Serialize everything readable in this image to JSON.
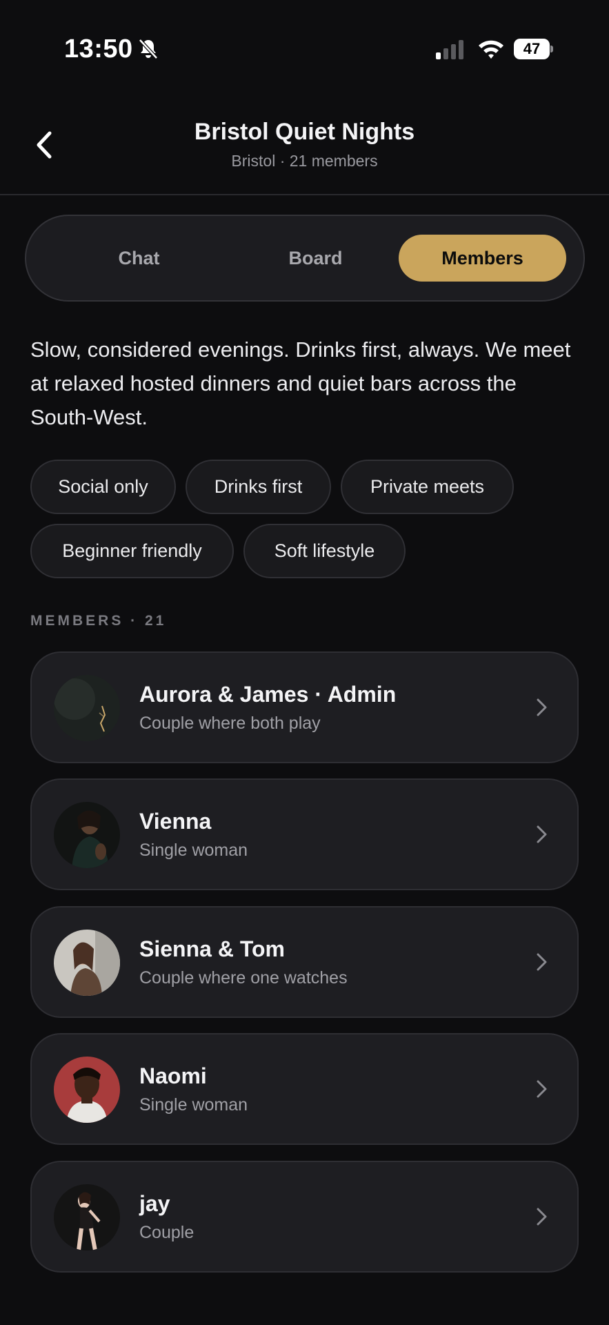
{
  "status_bar": {
    "time": "13:50",
    "battery": "47"
  },
  "header": {
    "title": "Bristol Quiet Nights",
    "subtitle": "Bristol · 21 members"
  },
  "tabs": [
    {
      "label": "Chat",
      "active": false
    },
    {
      "label": "Board",
      "active": false
    },
    {
      "label": "Members",
      "active": true
    }
  ],
  "description": "Slow, considered evenings. Drinks first, always. We meet at relaxed hosted dinners and quiet bars across the South-West.",
  "tags": [
    "Social only",
    "Drinks first",
    "Private meets",
    "Beginner friendly",
    "Soft lifestyle"
  ],
  "members_section": {
    "label": "MEMBERS · 21"
  },
  "members": [
    {
      "name": "Aurora & James · Admin",
      "type": "Couple where both play"
    },
    {
      "name": "Vienna",
      "type": "Single woman"
    },
    {
      "name": "Sienna & Tom",
      "type": "Couple where one watches"
    },
    {
      "name": "Naomi",
      "type": "Single woman"
    },
    {
      "name": "jay",
      "type": "Couple"
    }
  ],
  "colors": {
    "background": "#0d0d0f",
    "accent": "#caa55c",
    "card": "#1e1e22"
  }
}
